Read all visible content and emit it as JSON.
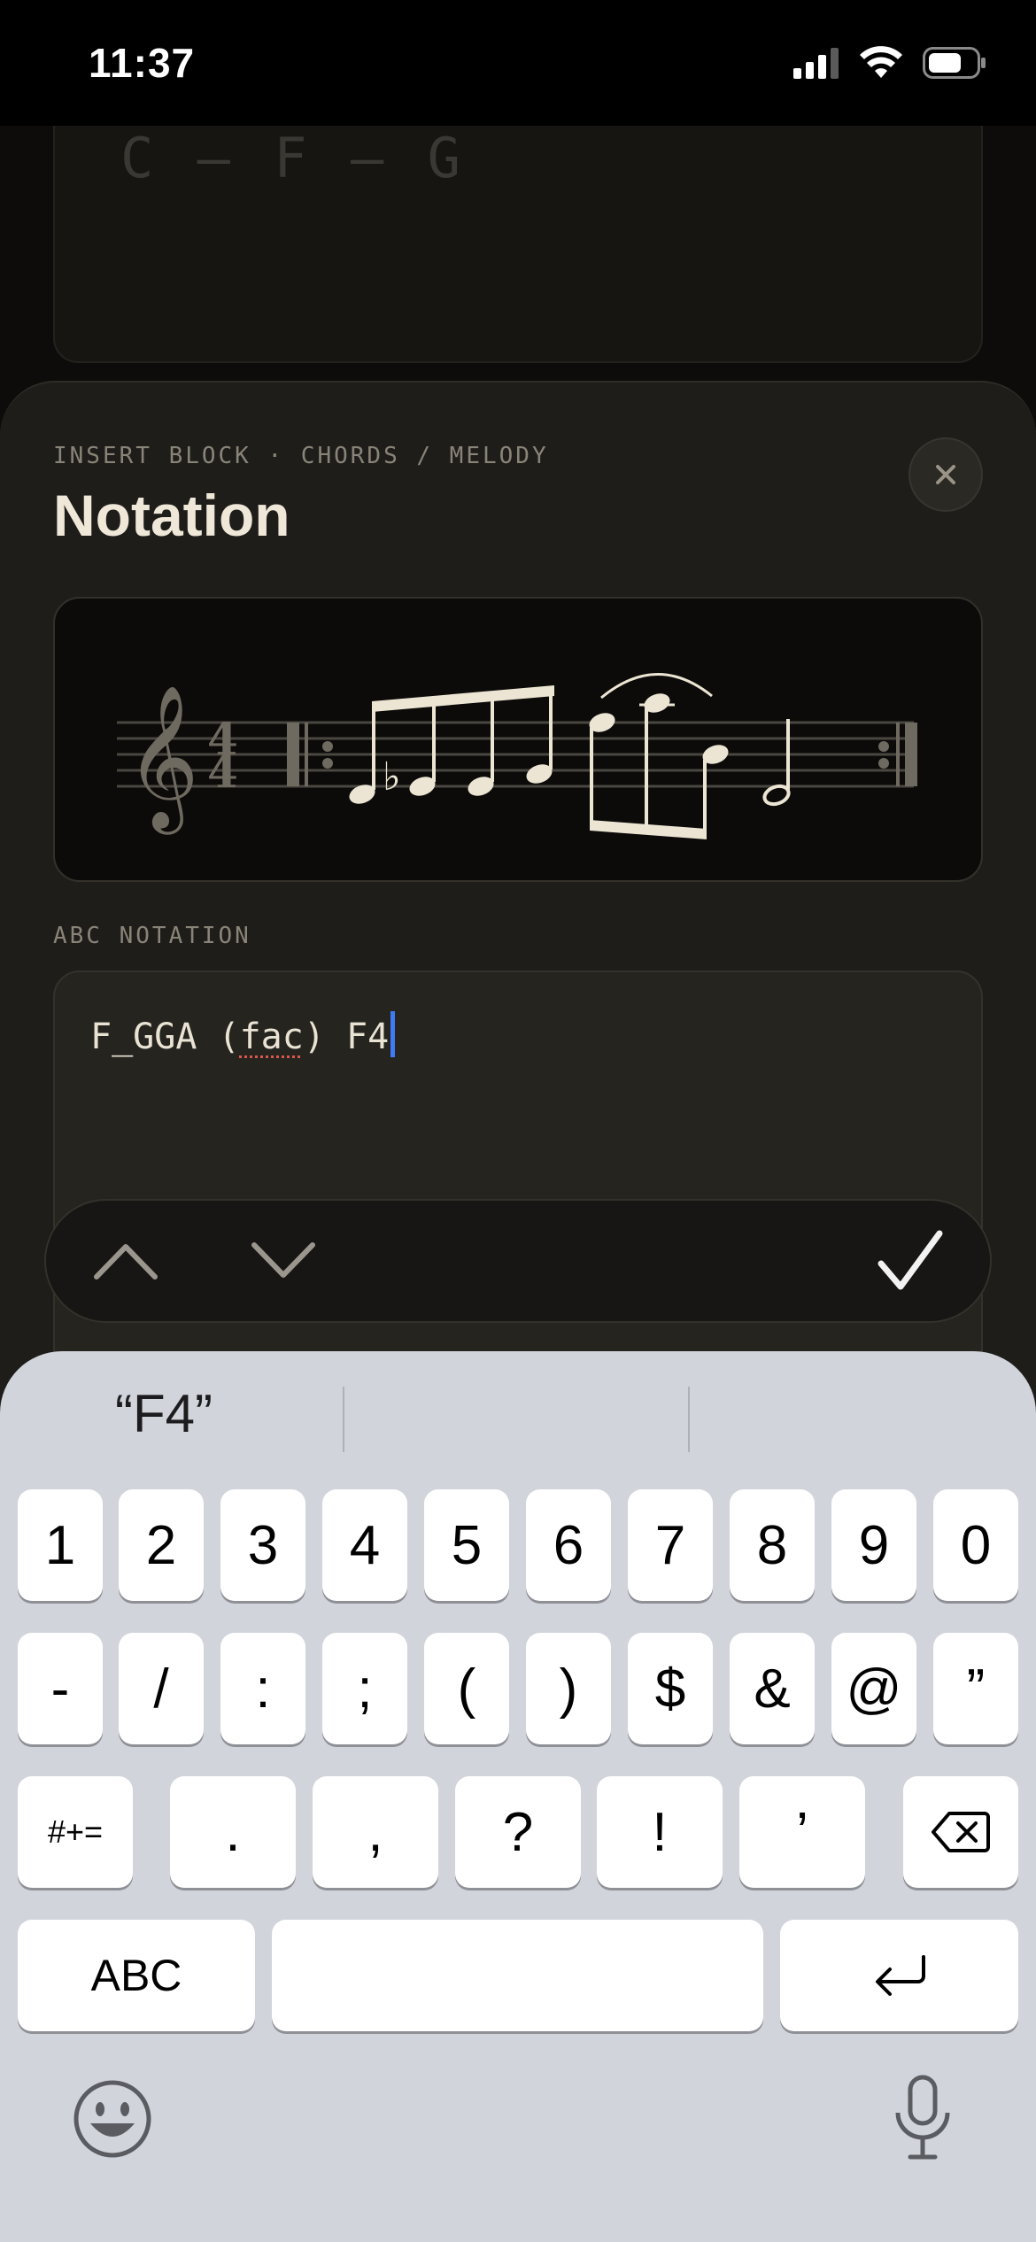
{
  "status": {
    "time": "11:37"
  },
  "background": {
    "chords": "C — F — G"
  },
  "sheet": {
    "eyebrow": "INSERT BLOCK · CHORDS / MELODY",
    "title": "Notation",
    "close_label": "×",
    "field_label": "ABC NOTATION",
    "abc": {
      "part1": "F_GGA (",
      "misspelled": "fac",
      "part2": ") F4"
    },
    "time_signature": {
      "top": "4",
      "bottom": "4"
    }
  },
  "accessory": {
    "up": "previous-field",
    "down": "next-field",
    "done": "done"
  },
  "keyboard": {
    "suggestions": [
      "“F4”",
      "",
      ""
    ],
    "row1": [
      "1",
      "2",
      "3",
      "4",
      "5",
      "6",
      "7",
      "8",
      "9",
      "0"
    ],
    "row2": [
      "-",
      "/",
      ":",
      ";",
      "(",
      ")",
      "$",
      "&",
      "@",
      "”"
    ],
    "row3": [
      ".",
      ",",
      "?",
      "!",
      "’"
    ],
    "symbols_key": "#+=",
    "abc_key": "ABC"
  },
  "colors": {
    "accent": "#3d7bf5",
    "sheet_bg": "#1e1d1a",
    "cream": "#efe8d8"
  }
}
